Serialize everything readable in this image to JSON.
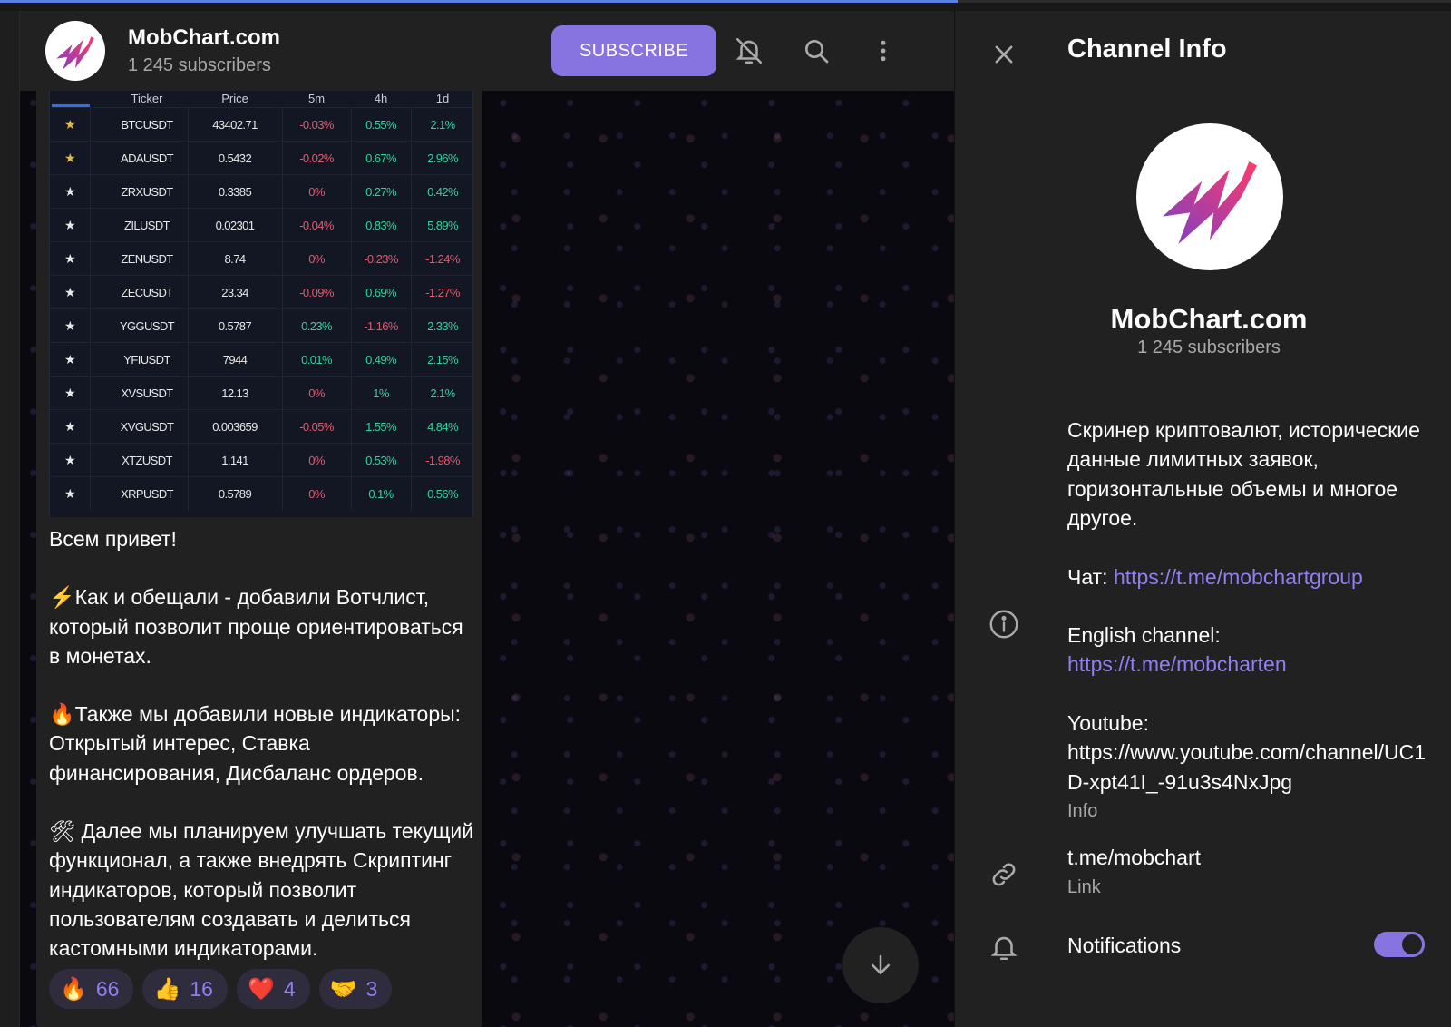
{
  "channel": {
    "name": "MobChart.com",
    "subscribers": "1 245 subscribers"
  },
  "header": {
    "subscribe_label": "SUBSCRIBE",
    "icons": [
      "bell-off-icon",
      "search-icon",
      "more-vertical-icon"
    ]
  },
  "loading_progress": 0.66,
  "screener": {
    "columns": [
      "Ticker",
      "Price",
      "5m",
      "4h",
      "1d"
    ],
    "rows": [
      {
        "starred": true,
        "ticker": "BTCUSDT",
        "price": "43402.71",
        "m5": "-0.03%",
        "h4": "0.55%",
        "d1": "2.1%"
      },
      {
        "starred": true,
        "ticker": "ADAUSDT",
        "price": "0.5432",
        "m5": "-0.02%",
        "h4": "0.67%",
        "d1": "2.96%"
      },
      {
        "starred": false,
        "ticker": "ZRXUSDT",
        "price": "0.3385",
        "m5": "0%",
        "h4": "0.27%",
        "d1": "0.42%"
      },
      {
        "starred": false,
        "ticker": "ZILUSDT",
        "price": "0.02301",
        "m5": "-0.04%",
        "h4": "0.83%",
        "d1": "5.89%"
      },
      {
        "starred": false,
        "ticker": "ZENUSDT",
        "price": "8.74",
        "m5": "0%",
        "h4": "-0.23%",
        "d1": "-1.24%"
      },
      {
        "starred": false,
        "ticker": "ZECUSDT",
        "price": "23.34",
        "m5": "-0.09%",
        "h4": "0.69%",
        "d1": "-1.27%"
      },
      {
        "starred": false,
        "ticker": "YGGUSDT",
        "price": "0.5787",
        "m5": "0.23%",
        "h4": "-1.16%",
        "d1": "2.33%"
      },
      {
        "starred": false,
        "ticker": "YFIUSDT",
        "price": "7944",
        "m5": "0.01%",
        "h4": "0.49%",
        "d1": "2.15%"
      },
      {
        "starred": false,
        "ticker": "XVSUSDT",
        "price": "12.13",
        "m5": "0%",
        "h4": "1%",
        "d1": "2.1%"
      },
      {
        "starred": false,
        "ticker": "XVGUSDT",
        "price": "0.003659",
        "m5": "-0.05%",
        "h4": "1.55%",
        "d1": "4.84%"
      },
      {
        "starred": false,
        "ticker": "XTZUSDT",
        "price": "1.141",
        "m5": "0%",
        "h4": "0.53%",
        "d1": "-1.98%"
      },
      {
        "starred": false,
        "ticker": "XRPUSDT",
        "price": "0.5789",
        "m5": "0%",
        "h4": "0.1%",
        "d1": "0.56%"
      }
    ]
  },
  "message": {
    "greeting": "Всем привет!",
    "para1": "⚡️Как и обещали - добавили Вотчлист, который позволит проще ориентироваться в монетах.",
    "para2": "🔥Также мы добавили новые индикаторы: Открытый интерес, Ставка финансирования, Дисбаланс ордеров.",
    "para3": "🛠 Далее мы планируем улучшать текущий функционал, а также внедрять Скриптинг индикаторов, который позволит пользователям создавать и делиться кастомными индикаторами."
  },
  "reactions": [
    {
      "emoji": "🔥",
      "count": "66"
    },
    {
      "emoji": "👍",
      "count": "16"
    },
    {
      "emoji": "❤️",
      "count": "4"
    },
    {
      "emoji": "🤝",
      "count": "3"
    }
  ],
  "info": {
    "title": "Channel Info",
    "description": "Скринер криптовалют, исторические данные лимитных заявок, горизонтальные объемы и многое другое.",
    "chat_label": "Чат: ",
    "chat_link": "https://t.me/mobchartgroup",
    "english_label": "English channel:",
    "english_link": "https://t.me/mobcharten",
    "youtube_label": "Youtube:",
    "youtube_link": "https://www.youtube.com/channel/UC1D-xpt41I_-91u3s4NxJpg",
    "info_caption": "Info",
    "link_value": "t.me/mobchart",
    "link_caption": "Link",
    "notifications_label": "Notifications",
    "notifications_on": true
  },
  "colors": {
    "accent": "#8774e1",
    "panel": "#212121",
    "positive": "#32d39a",
    "negative": "#e05a6e",
    "star_gold": "#e8b83a"
  }
}
